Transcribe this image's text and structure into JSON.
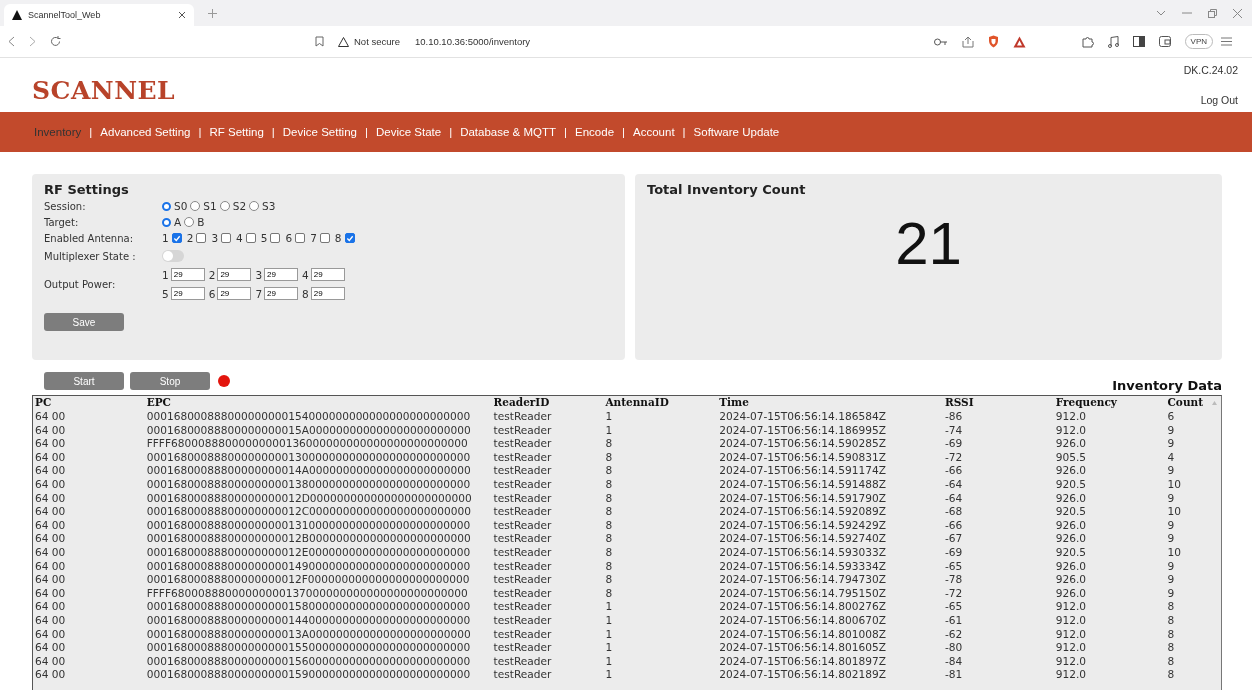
{
  "browser": {
    "tab_title": "ScannelTool_Web",
    "security": "Not secure",
    "url": "10.10.10.36:5000/inventory",
    "vpn": "VPN"
  },
  "header": {
    "logo": "SCANNEL",
    "version": "DK.C.24.02",
    "logout": "Log Out"
  },
  "nav_separator": "|",
  "nav": [
    {
      "label": "Inventory",
      "selected": true
    },
    {
      "label": "Advanced Setting",
      "selected": false
    },
    {
      "label": "RF Setting",
      "selected": false
    },
    {
      "label": "Device Setting",
      "selected": false
    },
    {
      "label": "Device State",
      "selected": false
    },
    {
      "label": "Database & MQTT",
      "selected": false
    },
    {
      "label": "Encode",
      "selected": false
    },
    {
      "label": "Account",
      "selected": false
    },
    {
      "label": "Software Update",
      "selected": false
    }
  ],
  "rf_settings": {
    "title": "RF Settings",
    "session": {
      "label": "Session:",
      "options": [
        {
          "label": "S0",
          "selected": true
        },
        {
          "label": "S1",
          "selected": false
        },
        {
          "label": "S2",
          "selected": false
        },
        {
          "label": "S3",
          "selected": false
        }
      ]
    },
    "target": {
      "label": "Target:",
      "options": [
        {
          "label": "A",
          "selected": true
        },
        {
          "label": "B",
          "selected": false
        }
      ]
    },
    "antenna": {
      "label": "Enabled Antenna:",
      "items": [
        {
          "label": "1",
          "checked": true
        },
        {
          "label": "2",
          "checked": false
        },
        {
          "label": "3",
          "checked": false
        },
        {
          "label": "4",
          "checked": false
        },
        {
          "label": "5",
          "checked": false
        },
        {
          "label": "6",
          "checked": false
        },
        {
          "label": "7",
          "checked": false
        },
        {
          "label": "8",
          "checked": true
        }
      ]
    },
    "multiplexer": {
      "label": "Multiplexer State :",
      "on": false
    },
    "power": {
      "label": "Output Power:",
      "fields": [
        {
          "label": "1",
          "value": "29"
        },
        {
          "label": "2",
          "value": "29"
        },
        {
          "label": "3",
          "value": "29"
        },
        {
          "label": "4",
          "value": "29"
        },
        {
          "label": "5",
          "value": "29"
        },
        {
          "label": "6",
          "value": "29"
        },
        {
          "label": "7",
          "value": "29"
        },
        {
          "label": "8",
          "value": "29"
        }
      ]
    },
    "save": "Save"
  },
  "total": {
    "title": "Total Inventory Count",
    "value": "21"
  },
  "controls": {
    "start": "Start",
    "stop": "Stop",
    "running": true
  },
  "inventory": {
    "title": "Inventory Data",
    "columns": [
      "PC",
      "EPC",
      "ReaderID",
      "AntennaID",
      "Time",
      "RSSI",
      "Frequency",
      "Count"
    ],
    "rows": [
      [
        "64 00",
        "000168000888000000000154000000000000000000000000",
        "testReader",
        "1",
        "2024-07-15T06:56:14.186584Z",
        "-86",
        "912.0",
        "6"
      ],
      [
        "64 00",
        "00016800088800000000015A000000000000000000000000",
        "testReader",
        "1",
        "2024-07-15T06:56:14.186995Z",
        "-74",
        "912.0",
        "9"
      ],
      [
        "64 00",
        "FFFF68000888000000000136000000000000000000000000",
        "testReader",
        "8",
        "2024-07-15T06:56:14.590285Z",
        "-69",
        "926.0",
        "9"
      ],
      [
        "64 00",
        "000168000888000000000130000000000000000000000000",
        "testReader",
        "8",
        "2024-07-15T06:56:14.590831Z",
        "-72",
        "905.5",
        "4"
      ],
      [
        "64 00",
        "00016800088800000000014A000000000000000000000000",
        "testReader",
        "8",
        "2024-07-15T06:56:14.591174Z",
        "-66",
        "926.0",
        "9"
      ],
      [
        "64 00",
        "000168000888000000000138000000000000000000000000",
        "testReader",
        "8",
        "2024-07-15T06:56:14.591488Z",
        "-64",
        "920.5",
        "10"
      ],
      [
        "64 00",
        "00016800088800000000012D000000000000000000000000",
        "testReader",
        "8",
        "2024-07-15T06:56:14.591790Z",
        "-64",
        "926.0",
        "9"
      ],
      [
        "64 00",
        "00016800088800000000012C000000000000000000000000",
        "testReader",
        "8",
        "2024-07-15T06:56:14.592089Z",
        "-68",
        "920.5",
        "10"
      ],
      [
        "64 00",
        "000168000888000000000131000000000000000000000000",
        "testReader",
        "8",
        "2024-07-15T06:56:14.592429Z",
        "-66",
        "926.0",
        "9"
      ],
      [
        "64 00",
        "00016800088800000000012B000000000000000000000000",
        "testReader",
        "8",
        "2024-07-15T06:56:14.592740Z",
        "-67",
        "926.0",
        "9"
      ],
      [
        "64 00",
        "00016800088800000000012E000000000000000000000000",
        "testReader",
        "8",
        "2024-07-15T06:56:14.593033Z",
        "-69",
        "920.5",
        "10"
      ],
      [
        "64 00",
        "000168000888000000000149000000000000000000000000",
        "testReader",
        "8",
        "2024-07-15T06:56:14.593334Z",
        "-65",
        "926.0",
        "9"
      ],
      [
        "64 00",
        "00016800088800000000012F000000000000000000000000",
        "testReader",
        "8",
        "2024-07-15T06:56:14.794730Z",
        "-78",
        "926.0",
        "9"
      ],
      [
        "64 00",
        "FFFF68000888000000000137000000000000000000000000",
        "testReader",
        "8",
        "2024-07-15T06:56:14.795150Z",
        "-72",
        "926.0",
        "9"
      ],
      [
        "64 00",
        "000168000888000000000158000000000000000000000000",
        "testReader",
        "1",
        "2024-07-15T06:56:14.800276Z",
        "-65",
        "912.0",
        "8"
      ],
      [
        "64 00",
        "000168000888000000000144000000000000000000000000",
        "testReader",
        "1",
        "2024-07-15T06:56:14.800670Z",
        "-61",
        "912.0",
        "8"
      ],
      [
        "64 00",
        "00016800088800000000013A000000000000000000000000",
        "testReader",
        "1",
        "2024-07-15T06:56:14.801008Z",
        "-62",
        "912.0",
        "8"
      ],
      [
        "64 00",
        "000168000888000000000155000000000000000000000000",
        "testReader",
        "1",
        "2024-07-15T06:56:14.801605Z",
        "-80",
        "912.0",
        "8"
      ],
      [
        "64 00",
        "000168000888000000000156000000000000000000000000",
        "testReader",
        "1",
        "2024-07-15T06:56:14.801897Z",
        "-84",
        "912.0",
        "8"
      ],
      [
        "64 00",
        "000168000888000000000159000000000000000000000000",
        "testReader",
        "1",
        "2024-07-15T06:56:14.802189Z",
        "-81",
        "912.0",
        "8"
      ]
    ]
  }
}
